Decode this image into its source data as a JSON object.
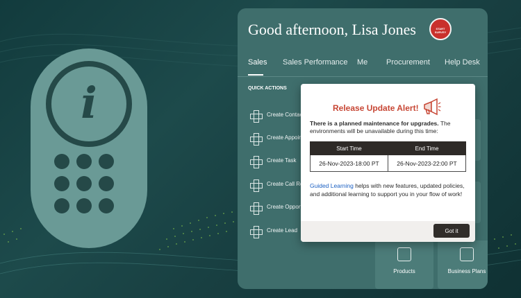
{
  "greeting": "Good afternoon, Lisa Jones",
  "survey_badge": {
    "line1": "START",
    "line2": "SURVEY"
  },
  "tabs": [
    {
      "label": "Sales",
      "active": true
    },
    {
      "label": "Sales Performance",
      "active": false
    },
    {
      "label": "Me",
      "active": false
    },
    {
      "label": "Procurement",
      "active": false
    },
    {
      "label": "Help Desk",
      "active": false
    }
  ],
  "quick_actions": {
    "title": "QUICK ACTIONS",
    "items": [
      {
        "label": "Create Contact"
      },
      {
        "label": "Create Appoint"
      },
      {
        "label": "Create Task"
      },
      {
        "label": "Create Call Rep"
      },
      {
        "label": "Create Opport"
      },
      {
        "label": "Create Lead"
      }
    ]
  },
  "tiles": [
    {
      "label": "Products",
      "icon": "phone-icon"
    },
    {
      "label": "Business Plans",
      "icon": "briefcase-icon"
    }
  ],
  "dialog": {
    "title": "Release Update Alert!",
    "icon": "megaphone-icon",
    "message_bold": "There is a planned maintenance for upgrades.",
    "message_rest": " The environments will be unavailable during this time:",
    "table": {
      "headers": [
        "Start Time",
        "End Time"
      ],
      "rows": [
        [
          "26-Nov-2023-18:00 PT",
          "26-Nov-2023-22:00 PT"
        ]
      ]
    },
    "link_text": "Guided Learning",
    "info_text": " helps with new features, updated policies, and additional learning to support you in your flow of work!",
    "button_label": "Got it"
  },
  "colors": {
    "background": "#1d4a4b",
    "panel": "#3f6e6c",
    "phone": "#6a9a96",
    "alert_title": "#c74634",
    "link": "#1a5fc2",
    "button": "#312d2a"
  },
  "phone_graphic": {
    "icon": "info-icon",
    "glyph": "i"
  }
}
